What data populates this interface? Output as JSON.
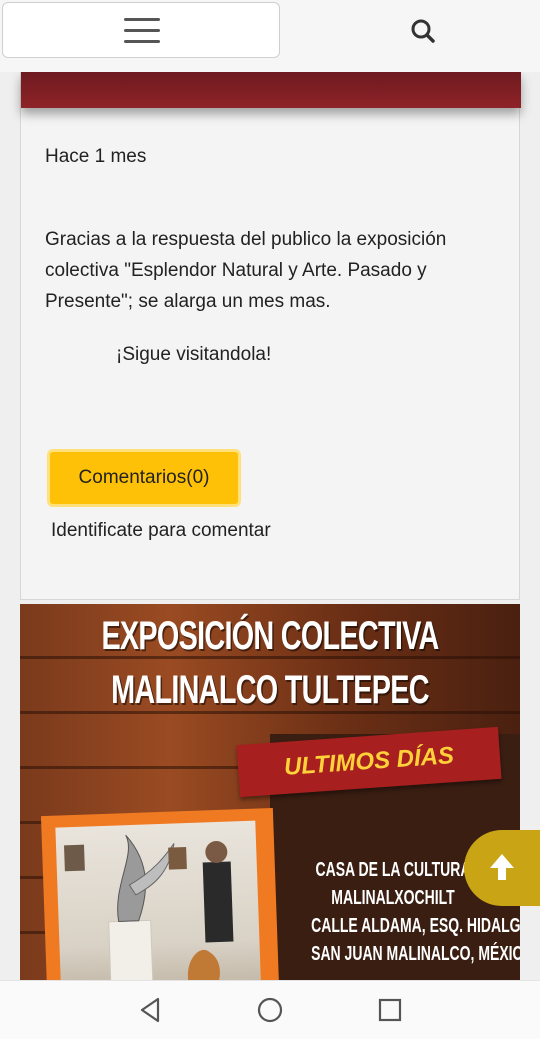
{
  "post": {
    "time": "Hace 1 mes",
    "body": "Gracias a la respuesta del publico la exposición colectiva \"Esplendor Natural y Arte. Pasado y Presente\"; se alarga un mes mas.",
    "sub": "¡Sigue visitandola!",
    "comments_label": "Comentarios(0)",
    "login_prompt": "Identificate para comentar"
  },
  "poster": {
    "title_line1": "EXPOSICIÓN COLECTIVA",
    "title_line2": "MALINALCO TULTEPEC",
    "ribbon": "ULTIMOS DÍAS",
    "address": [
      "CASA DE LA CULTURA",
      "MALINALXOCHILT",
      "CALLE ALDAMA, ESQ. HIDALGO,",
      "SAN JUAN MALINALCO, MÉXICO."
    ]
  },
  "icons": {
    "menu": "hamburger-icon",
    "search": "search-icon",
    "scroll_top": "arrow-up-icon",
    "back": "back-triangle-icon",
    "home": "home-circle-icon",
    "recents": "recents-square-icon"
  },
  "colors": {
    "accent": "#ffc107",
    "scroll_button": "#c9a414",
    "ribbon": "#a81f1f"
  }
}
